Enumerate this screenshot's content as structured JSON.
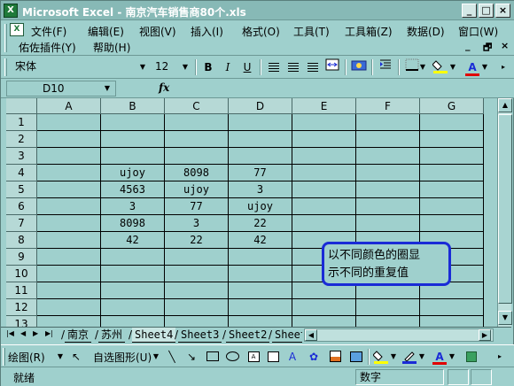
{
  "window": {
    "title": "Microsoft Excel - 南京汽车销售商80个.xls",
    "app_icon": "excel-icon",
    "controls": [
      "_",
      "□",
      "×"
    ]
  },
  "menu": {
    "doc_icon": "workbook-icon",
    "row1": [
      "文件(F)",
      "编辑(E)",
      "视图(V)",
      "插入(I)",
      "格式(O)",
      "工具(T)",
      "工具箱(Z)",
      "数据(D)",
      "窗口(W)"
    ],
    "row2": [
      "佑佐插件(Y)",
      "帮助(H)"
    ],
    "mdi_controls": [
      "_",
      "🗗",
      "×"
    ]
  },
  "toolbar": {
    "font_name": "宋体",
    "font_size": "12",
    "bold": "B",
    "italic": "I",
    "underline": "U",
    "font_color_letter": "A",
    "font_color": "#e00000",
    "fill_color": "#ffff00"
  },
  "formula_bar": {
    "name_box": "D10",
    "fx_label": "fx",
    "formula": ""
  },
  "grid": {
    "columns": [
      "A",
      "B",
      "C",
      "D",
      "E",
      "F",
      "G"
    ],
    "rows": [
      "1",
      "2",
      "3",
      "4",
      "5",
      "6",
      "7",
      "8",
      "9",
      "10",
      "11",
      "12",
      "13"
    ],
    "cells": [
      [
        "",
        "",
        "",
        "",
        "",
        "",
        ""
      ],
      [
        "",
        "",
        "",
        "",
        "",
        "",
        ""
      ],
      [
        "",
        "",
        "",
        "",
        "",
        "",
        ""
      ],
      [
        "",
        "ujoy",
        "8098",
        "77",
        "",
        "",
        ""
      ],
      [
        "",
        "4563",
        "ujoy",
        "3",
        "",
        "",
        ""
      ],
      [
        "",
        "3",
        "77",
        "ujoy",
        "",
        "",
        ""
      ],
      [
        "",
        "8098",
        "3",
        "22",
        "",
        "",
        ""
      ],
      [
        "",
        "42",
        "22",
        "42",
        "",
        "",
        ""
      ],
      [
        "",
        "",
        "",
        "",
        "",
        "",
        ""
      ],
      [
        "",
        "",
        "",
        "",
        "",
        "",
        ""
      ],
      [
        "",
        "",
        "",
        "",
        "",
        "",
        ""
      ],
      [
        "",
        "",
        "",
        "",
        "",
        "",
        ""
      ],
      [
        "",
        "",
        "",
        "",
        "",
        "",
        ""
      ]
    ],
    "note_line1": "以不同颜色的圈显",
    "note_line2": "示不同的重复值"
  },
  "sheets": {
    "tabs": [
      "南京",
      "苏州",
      "Sheet4",
      "Sheet3",
      "Sheet2",
      "Sheet"
    ],
    "active": "Sheet4"
  },
  "drawing": {
    "draw_label": "绘图(R)",
    "autoshapes_label": "自选图形(U)"
  },
  "status": {
    "left": "就绪",
    "panel": "数字"
  }
}
